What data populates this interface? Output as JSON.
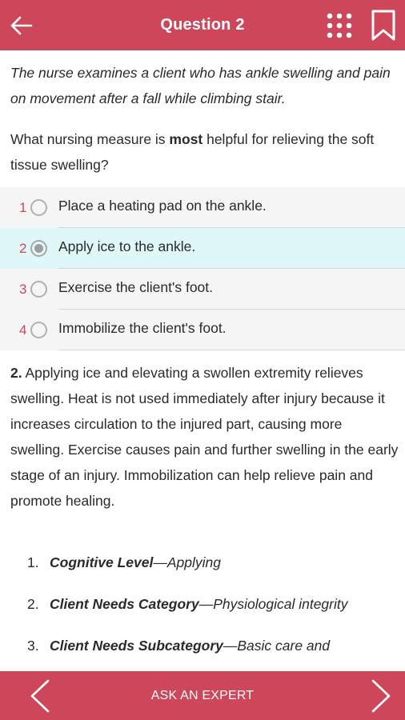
{
  "header": {
    "title": "Question 2",
    "icons": [
      "back-arrow-icon",
      "grid-icon",
      "bookmark-icon"
    ]
  },
  "stem": {
    "text": "The nurse examines a client who has ankle swelling and pain on movement after a fall while climbing stair."
  },
  "question": {
    "before": "What nursing measure is ",
    "bold": "most",
    "after": " helpful for relieving the soft tissue swelling?"
  },
  "options": [
    {
      "number": "1",
      "label": "Place a heating pad on the ankle.",
      "selected": false
    },
    {
      "number": "2",
      "label": "Apply ice to the ankle.",
      "selected": true
    },
    {
      "number": "3",
      "label": "Exercise the client's foot.",
      "selected": false
    },
    {
      "number": "4",
      "label": "Immobilize the client's foot.",
      "selected": false
    }
  ],
  "explanation": {
    "lead": "2.",
    "text": " Applying ice and elevating a swollen extremity relieves swelling. Heat is not used immediately after injury because it increases circulation to the injured part, causing more swelling. Exercise causes pain and further swelling in the early stage of an injury. Immobilization can help relieve pain and promote healing."
  },
  "meta": [
    {
      "number": "1.",
      "key": "Cognitive Level",
      "value": "—Applying"
    },
    {
      "number": "2.",
      "key": "Client Needs Category",
      "value": "—Physiological integrity"
    },
    {
      "number": "3.",
      "key": "Client Needs Subcategory",
      "value": "—Basic care and"
    }
  ],
  "footer": {
    "expert_label": "ASK AN EXPERT",
    "icons": [
      "chevron-left-icon",
      "chevron-right-icon"
    ]
  },
  "colors": {
    "brand": "#cd4659",
    "selected_bg": "#e0f7f7",
    "option_number": "#d0455c"
  }
}
